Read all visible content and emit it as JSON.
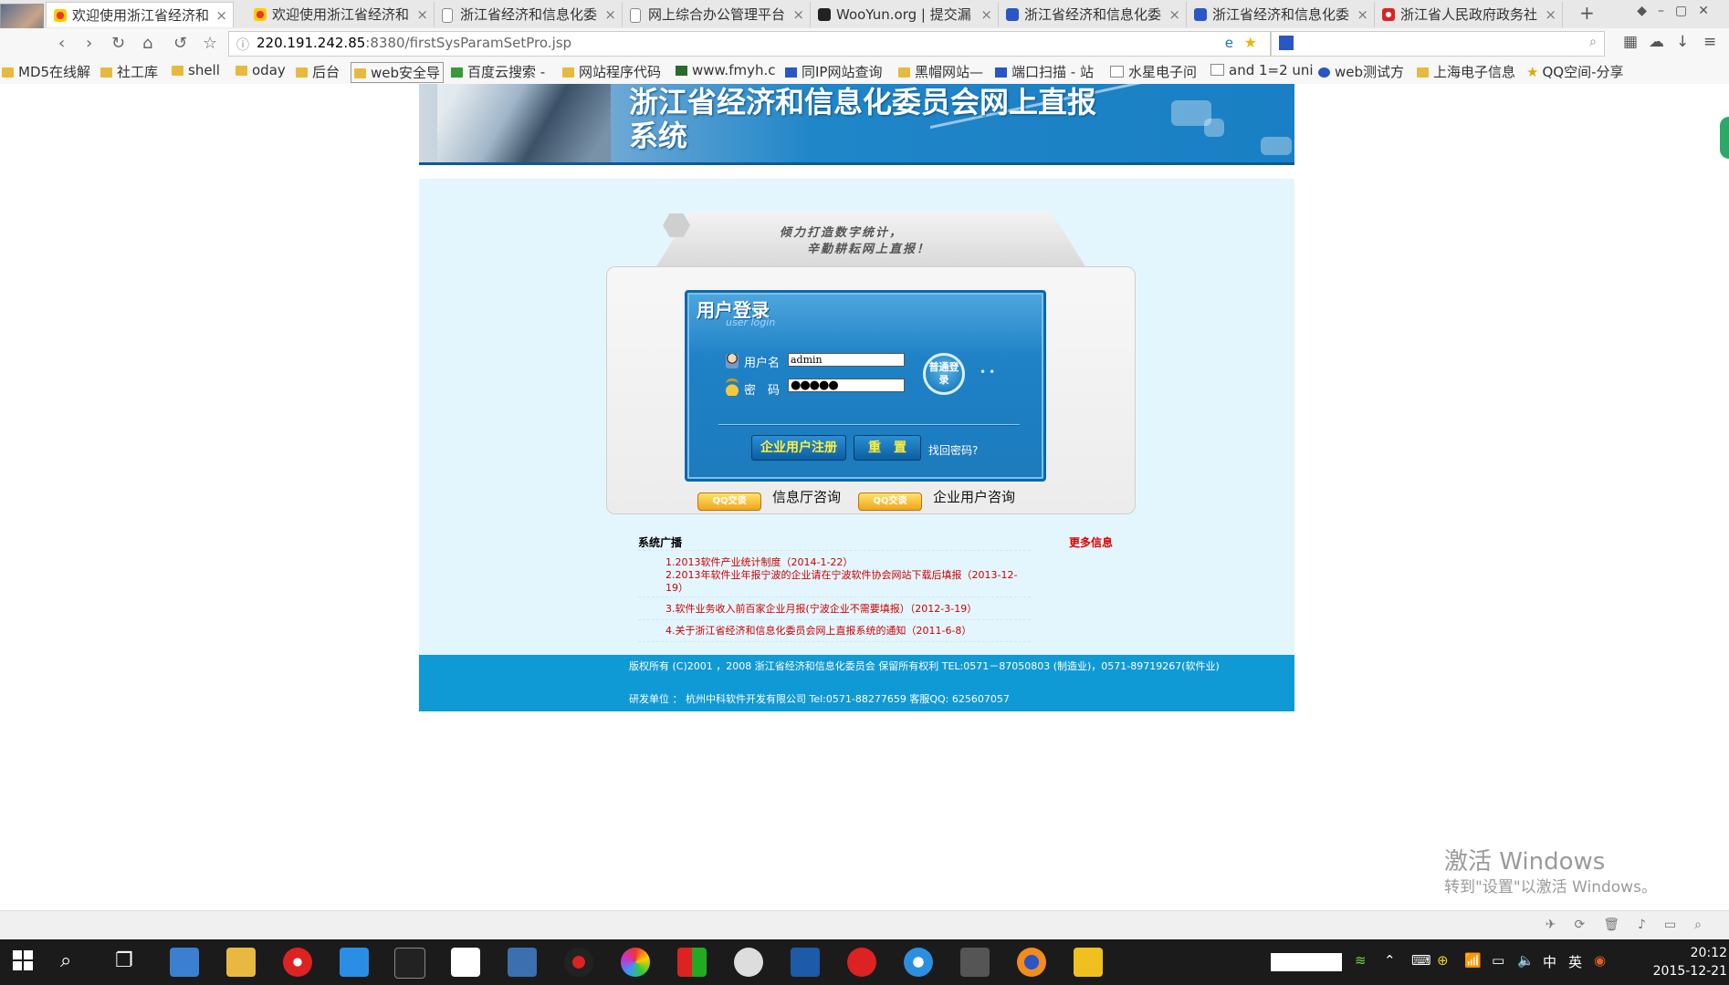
{
  "browser": {
    "tabs": [
      {
        "label": "欢迎使用浙江省经济和",
        "active": true
      },
      {
        "label": "欢迎使用浙江省经济和",
        "active": false
      },
      {
        "label": "浙江省经济和信息化委",
        "active": false
      },
      {
        "label": "网上综合办公管理平台",
        "active": false
      },
      {
        "label": "WooYun.org | 提交漏",
        "active": false
      },
      {
        "label": "浙江省经济和信息化委",
        "active": false
      },
      {
        "label": "浙江省经济和信息化委",
        "active": false
      },
      {
        "label": "浙江省人民政府政务社",
        "active": false
      }
    ],
    "close_glyph": "×",
    "new_tab_glyph": "+",
    "url_host": "220.191.242.85",
    "url_rest": ":8380/firstSysParamSetPro.jsp",
    "bookmarks": [
      {
        "label": "MD5在线解",
        "icon": "folder"
      },
      {
        "label": "社工库",
        "icon": "folder"
      },
      {
        "label": "shell",
        "icon": "folder"
      },
      {
        "label": "oday",
        "icon": "folder"
      },
      {
        "label": "后台",
        "icon": "folder"
      },
      {
        "label": "web安全导",
        "icon": "folder"
      },
      {
        "label": "百度云搜索 -",
        "icon": "site"
      },
      {
        "label": "网站程序代码",
        "icon": "folder"
      },
      {
        "label": "www.fmyh.c",
        "icon": "site"
      },
      {
        "label": "同IP网站查询",
        "icon": "site"
      },
      {
        "label": "黑帽网站—",
        "icon": "folder"
      },
      {
        "label": "端口扫描 - 站",
        "icon": "site"
      },
      {
        "label": "水星电子问",
        "icon": "doc"
      },
      {
        "label": "and 1=2 uni",
        "icon": "doc"
      },
      {
        "label": "web测试方",
        "icon": "site"
      },
      {
        "label": "上海电子信息",
        "icon": "folder"
      },
      {
        "label": "QQ空间-分享",
        "icon": "star"
      }
    ]
  },
  "page": {
    "banner_title": "浙江省经济和信息化委员会网上直报系统",
    "slogan_line1": "倾力打造数字统计，",
    "slogan_line2": "辛勤耕耘网上直报！",
    "login": {
      "title": "用户登录",
      "subtitle": "user login",
      "username_label": "用户名",
      "username_value": "admin",
      "password_label": "密　码",
      "password_value": "●●●●●",
      "login_button": "普通登录",
      "register_button": "企业用户注册",
      "reset_button": "重　置",
      "forgot_link": "找回密码?"
    },
    "consult": {
      "qq_badge": "QQ交谈",
      "office_label": "信息厅咨询",
      "enterprise_label": "企业用户咨询"
    },
    "news": {
      "heading": "系统广播",
      "more": "更多信息",
      "items": [
        "1.2013软件产业统计制度（2014-1-22）",
        "2.2013年软件业年报宁波的企业请在宁波软件协会网站下载后填报（2013-12-19）",
        "3.软件业务收入前百家企业月报(宁波企业不需要填报）（2012-3-19）",
        "4.关于浙江省经济和信息化委员会网上直报系统的通知（2011-6-8）"
      ]
    },
    "footer": {
      "line1": "版权所有 (C)2001 ，2008 浙江省经济和信息化委员会  保留所有权利   TEL:0571－87050803 (制造业)，0571-89719267(软件业)",
      "line2": "研发单位 ：  杭州中科软件开发有限公司     Tel:0571-88277659 客服QQ: 625607057"
    }
  },
  "os": {
    "watermark_line1": "激活 Windows",
    "watermark_line2": "转到\"设置\"以激活 Windows。",
    "clock_time": "20:12",
    "clock_date": "2015-12-21",
    "ime": "英",
    "ime2": "中"
  },
  "colors": {
    "banner_blue": "#1a7fc4",
    "content_bg": "#e4f6fd",
    "footer_blue": "#109ad5",
    "news_red": "#cc0000",
    "button_text_yellow": "#ffef3b"
  }
}
